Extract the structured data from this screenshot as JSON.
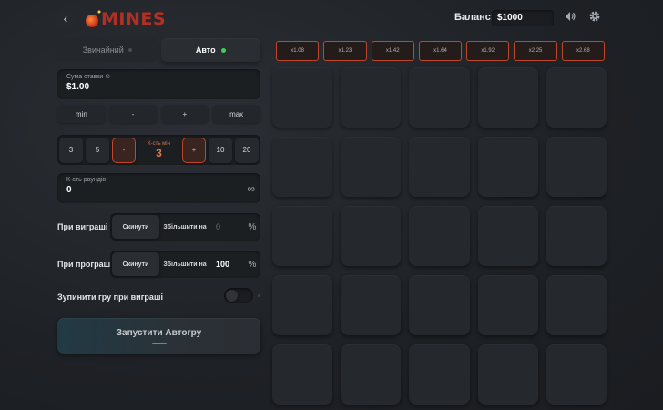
{
  "header": {
    "back_icon": "chevron-left-icon",
    "logo_text": "MINES",
    "balance_label": "Баланс:",
    "balance_value": "$1000",
    "sound_icon": "speaker-icon",
    "settings_icon": "gear-icon"
  },
  "mode_tabs": [
    {
      "label": "Звичайний",
      "active": false
    },
    {
      "label": "Авто",
      "active": true
    }
  ],
  "bet": {
    "label": "Сума ставки ⊙",
    "value": "$1.00",
    "controls": [
      "min",
      "-",
      "+",
      "max"
    ]
  },
  "mines": {
    "presets_left": [
      "3",
      "5"
    ],
    "decrement": "-",
    "label": "К-сть мін",
    "value": "3",
    "increment": "+",
    "presets_right": [
      "10",
      "20"
    ]
  },
  "rounds": {
    "label": "К-сть раундів",
    "value": "0",
    "infinity": "∞"
  },
  "on_win": {
    "label": "При виграші",
    "reset_label": "Скинути",
    "increase_label": "Збільшити на",
    "value": "0",
    "unit": "%"
  },
  "on_loss": {
    "label": "При програші",
    "reset_label": "Скинути",
    "increase_label": "Збільшити на",
    "value": "100",
    "unit": "%"
  },
  "stop_on_win": {
    "label": "Зупинити гру при виграші",
    "enabled": false
  },
  "start_button": {
    "label": "Запустити Автогру"
  },
  "multipliers": [
    "x1.08",
    "x1.23",
    "x1.42",
    "x1.64",
    "x1.92",
    "x2.25",
    "x2.68"
  ],
  "grid": {
    "rows": 5,
    "cols": 5
  },
  "colors": {
    "accent": "#c0462c",
    "active_dot": "#3fcf5c",
    "background": "#1e2125"
  }
}
